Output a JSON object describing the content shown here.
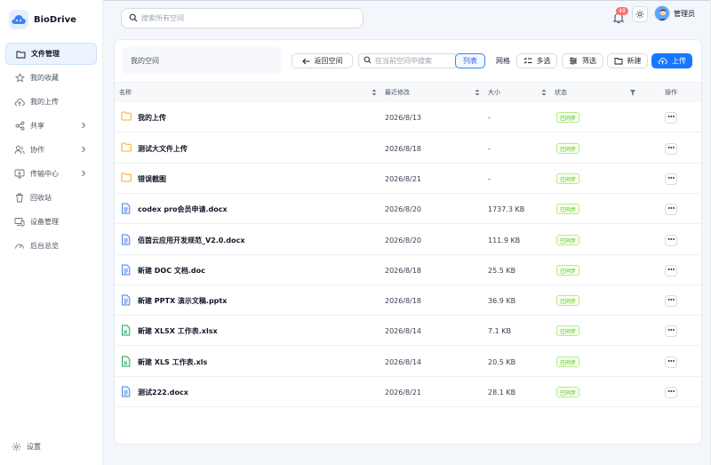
{
  "brand": {
    "name": "BioDrive"
  },
  "sidebar": {
    "items": [
      {
        "label": "文件管理",
        "icon": "folder-icon",
        "active": true
      },
      {
        "label": "我的收藏",
        "icon": "star-icon"
      },
      {
        "label": "我的上传",
        "icon": "cloud-upload-icon"
      },
      {
        "label": "共享",
        "icon": "share-icon",
        "has_children": true
      },
      {
        "label": "协作",
        "icon": "users-icon",
        "has_children": true
      },
      {
        "label": "传输中心",
        "icon": "transfer-icon",
        "has_children": true
      },
      {
        "label": "回收站",
        "icon": "trash-icon"
      },
      {
        "label": "设备管理",
        "icon": "device-icon"
      },
      {
        "label": "后台总览",
        "icon": "dashboard-icon"
      }
    ],
    "settings_label": "设置"
  },
  "header": {
    "search_placeholder": "搜索所有空间",
    "notification_count": "49",
    "user_name": "管理员"
  },
  "toolbar": {
    "space_label": "我的空间",
    "back_label": "返回空间",
    "search_placeholder": "在当前空间中搜索",
    "view_list": "列表",
    "view_grid": "网格",
    "multi_select": "多选",
    "filter": "筛选",
    "new": "新建",
    "upload": "上传"
  },
  "table": {
    "columns": {
      "name": "名称",
      "modified": "最近修改",
      "size": "大小",
      "status": "状态",
      "actions": "操作"
    },
    "rows": [
      {
        "name": "我的上传",
        "type": "folder",
        "modified": "2026/8/13",
        "size": "-",
        "status": "已同步"
      },
      {
        "name": "测试大文件上传",
        "type": "folder",
        "modified": "2026/8/18",
        "size": "-",
        "status": "已同步"
      },
      {
        "name": "错误截图",
        "type": "folder",
        "modified": "2026/8/21",
        "size": "-",
        "status": "已同步"
      },
      {
        "name": "codex pro会员申请.docx",
        "type": "doc",
        "modified": "2026/8/20",
        "size": "1737.3 KB",
        "status": "已同步"
      },
      {
        "name": "佰茵云应用开发规范_V2.0.docx",
        "type": "doc",
        "modified": "2026/8/20",
        "size": "111.9 KB",
        "status": "已同步"
      },
      {
        "name": "新建 DOC 文档.doc",
        "type": "doc",
        "modified": "2026/8/18",
        "size": "25.5 KB",
        "status": "已同步"
      },
      {
        "name": "新建 PPTX 演示文稿.pptx",
        "type": "doc",
        "modified": "2026/8/18",
        "size": "36.9 KB",
        "status": "已同步"
      },
      {
        "name": "新建 XLSX 工作表.xlsx",
        "type": "sheet",
        "modified": "2026/8/14",
        "size": "7.1 KB",
        "status": "已同步"
      },
      {
        "name": "新建 XLS 工作表.xls",
        "type": "sheet",
        "modified": "2026/8/14",
        "size": "20.5 KB",
        "status": "已同步"
      },
      {
        "name": "测试222.docx",
        "type": "doc",
        "modified": "2026/8/21",
        "size": "28.1 KB",
        "status": "已同步"
      }
    ],
    "more_label": "•••"
  },
  "colors": {
    "accent": "#1677ff",
    "folder": "#f5b02e",
    "doc": "#4a86e8",
    "sheet": "#22a45d",
    "status_green": "#52c41a",
    "badge": "#f87171"
  }
}
